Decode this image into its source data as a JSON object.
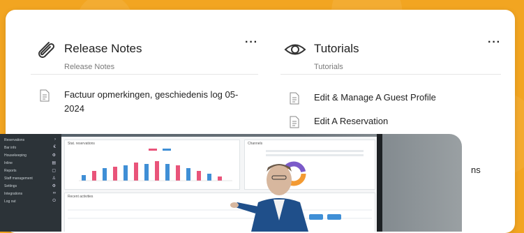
{
  "release": {
    "title": "Release Notes",
    "subtitle": "Release Notes",
    "more": "···",
    "items": [
      {
        "line1": "Factuur opmerkingen, geschiedenis log 05-",
        "line2": "2024"
      }
    ]
  },
  "tutorials": {
    "title": "Tutorials",
    "subtitle": "Tutorials",
    "more": "···",
    "items": [
      "Edit & Manage A Guest Profile",
      "Edit A Reservation"
    ],
    "cut_off_text": "ns"
  },
  "photo": {
    "sidebar_items": [
      "Reservations",
      "Bar info",
      "Housekeeping",
      "Inline",
      "Reports",
      "Staff management",
      "Settings",
      "Integrations",
      "Log out"
    ],
    "main_widget_title": "Stat. reservations",
    "side_widget_title": "Channels",
    "table_title": "Recent activities",
    "colors": {
      "pink": "#e9547a",
      "blue": "#3f8fd6",
      "orange": "#f39a32",
      "purple": "#7b5ac9"
    }
  }
}
